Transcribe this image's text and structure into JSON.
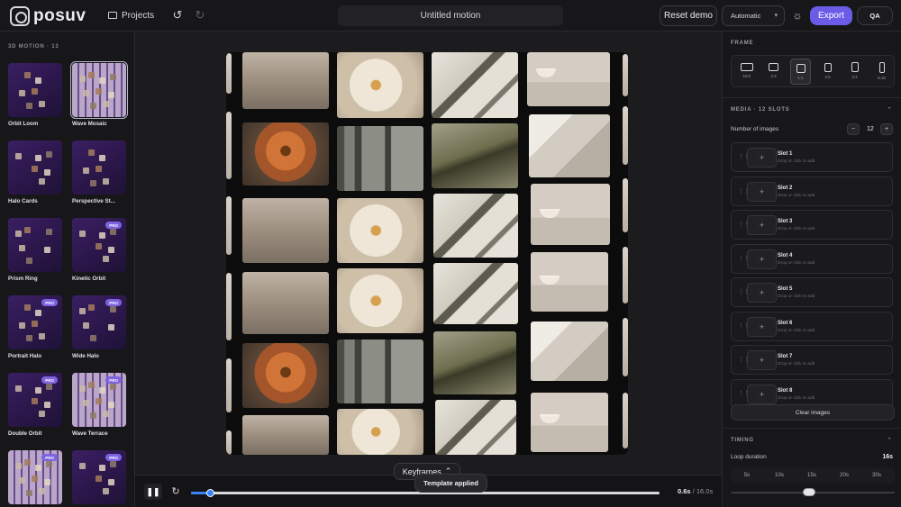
{
  "app": {
    "logo_text": "posuv",
    "title": "Untitled motion"
  },
  "toolbar": {
    "projects_label": "Projects",
    "reset_label": "Reset demo",
    "mode_value": "Automatic",
    "export_label": "Export",
    "qa_label": "QA"
  },
  "left": {
    "section_title": "3D MOTION · 13",
    "pro_label": "PRO",
    "templates": [
      {
        "label": "Orbit Loom",
        "pro": false,
        "selected": false
      },
      {
        "label": "Wave Mosaic",
        "pro": false,
        "selected": true
      },
      {
        "label": "Halo Cards",
        "pro": false,
        "selected": false
      },
      {
        "label": "Perspective St...",
        "pro": false,
        "selected": false
      },
      {
        "label": "Prism Ring",
        "pro": false,
        "selected": false
      },
      {
        "label": "Kinetic Orbit",
        "pro": true,
        "selected": false
      },
      {
        "label": "Portrait Halo",
        "pro": true,
        "selected": false
      },
      {
        "label": "Wide Halo",
        "pro": true,
        "selected": false
      },
      {
        "label": "Double Orbit",
        "pro": true,
        "selected": false
      },
      {
        "label": "Wave Terrace",
        "pro": true,
        "selected": false
      },
      {
        "label": "",
        "pro": true,
        "selected": false
      },
      {
        "label": "",
        "pro": true,
        "selected": false
      }
    ]
  },
  "timeline": {
    "current_time": "0.6s",
    "separator": " / ",
    "total_time": "16.0s",
    "progress": 0.04,
    "keyframes_label": "Keyframes",
    "toast": "Template applied"
  },
  "right": {
    "frame_title": "FRAME",
    "aspects": [
      {
        "label": "16:9",
        "selected": false
      },
      {
        "label": "4:3",
        "selected": false
      },
      {
        "label": "1:1",
        "selected": true
      },
      {
        "label": "4:5",
        "selected": false
      },
      {
        "label": "3:4",
        "selected": false
      },
      {
        "label": "9:16",
        "selected": false
      }
    ],
    "media_title": "MEDIA · 12 SLOTS",
    "number_label": "Number of images",
    "number_value": "12",
    "minus": "−",
    "plus": "+",
    "slot_hint": "Drop or click to add",
    "slots": [
      "Slot 1",
      "Slot 2",
      "Slot 3",
      "Slot 4",
      "Slot 5",
      "Slot 6",
      "Slot 7",
      "Slot 8"
    ],
    "clear_label": "Clear images",
    "timing_title": "TIMING",
    "loop_label": "Loop duration",
    "loop_value": "16s",
    "durations": [
      "5s",
      "10s",
      "15s",
      "20s",
      "30s"
    ],
    "duration_level": 0.48
  },
  "colors": {
    "accent": "#6b5ce8",
    "progress": "#3b82f6",
    "pro_badge": "#7d63e0"
  }
}
